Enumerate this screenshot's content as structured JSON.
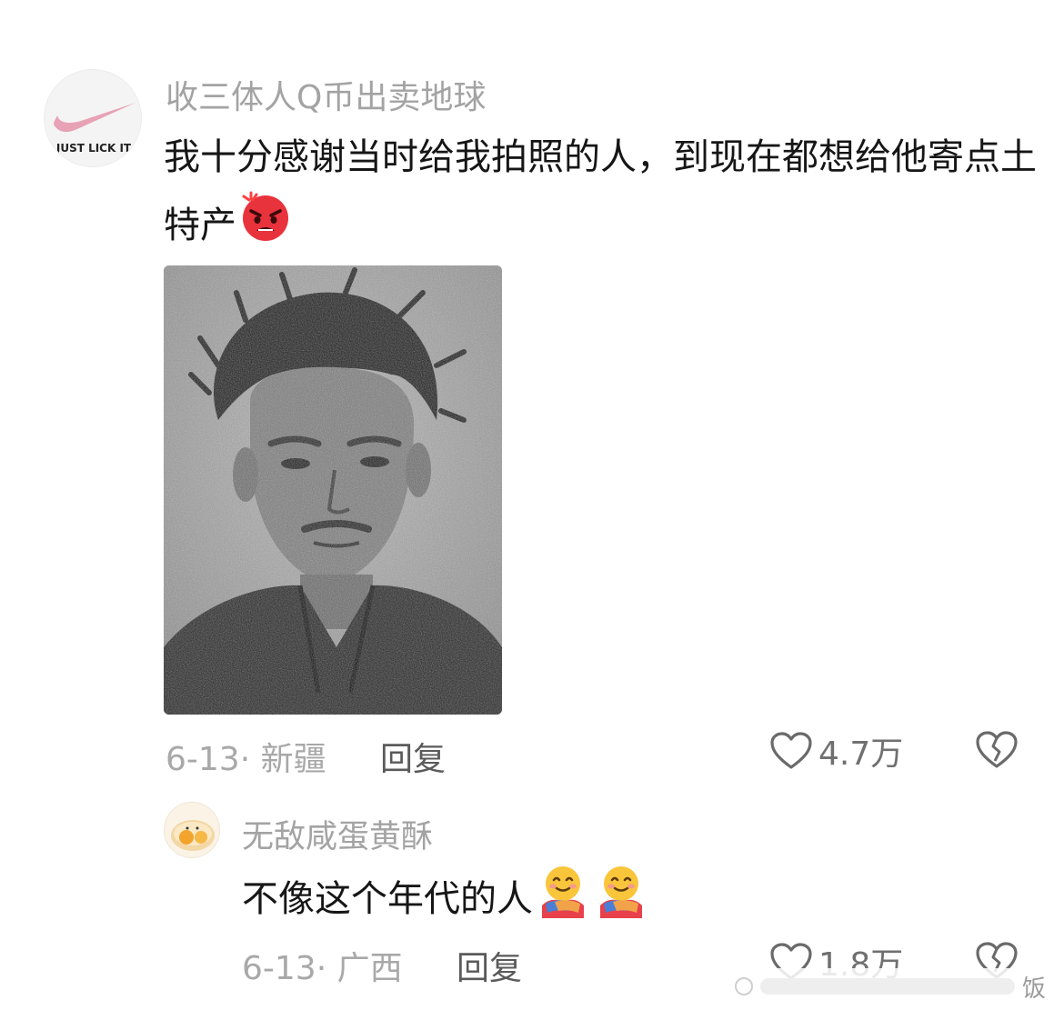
{
  "comments": [
    {
      "username": "收三体人Q币出卖地球",
      "avatar_logo_text": "JUST LICK IT",
      "text": "我十分感谢当时给我拍照的人，到现在都想给他寄点土特产",
      "emoji": "angry-face-emoji",
      "date_location": "6-13· 新疆",
      "reply_label": "回复",
      "like_count": "4.7万"
    },
    {
      "username": "无敌咸蛋黄酥",
      "text": "不像这个年代的人",
      "emoji": "hugging-face-emoji",
      "date_location": "6-13· 广西",
      "reply_label": "回复",
      "like_count": "1.8万"
    }
  ],
  "watermark_text": "饭",
  "colors": {
    "username": "#a3a3a3",
    "comment_text": "#161616",
    "meta": "#a8a8a8",
    "reply": "#5a5a5a",
    "logo_swoosh": "#e8a2b6"
  }
}
